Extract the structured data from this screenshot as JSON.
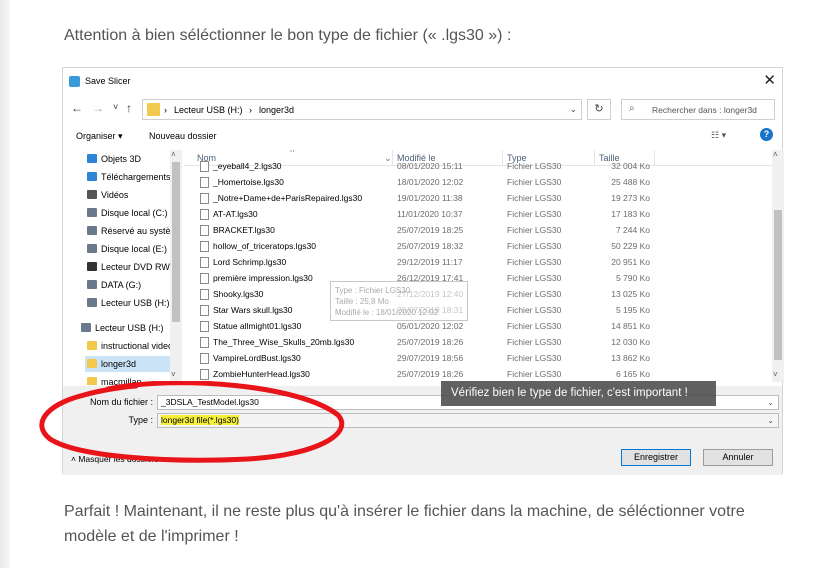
{
  "article": {
    "intro": "Attention à bien séléctionner le bon type de fichier (« .lgs30 ») :",
    "outro": "Parfait ! Maintenant, il ne reste plus qu'à insérer le fichier dans la machine, de séléctionner votre modèle et de l'imprimer !"
  },
  "dialog": {
    "title": "Save Slicer",
    "close": "✕",
    "nav_back": "←",
    "nav_forward": "→",
    "nav_recent": "˅",
    "nav_up": "↑",
    "breadcrumb": [
      "Lecteur USB (H:)",
      "longer3d"
    ],
    "crumb_sep": "›",
    "addr_dropdown": "⌄",
    "refresh": "↻",
    "search_icon": "⌕",
    "search_placeholder": "Rechercher dans : longer3d",
    "toolbar": {
      "organize": "Organiser ▾",
      "new_folder": "Nouveau dossier",
      "view": "☷ ▾",
      "help": "?"
    },
    "nav_pane": [
      "Objets 3D",
      "Téléchargements",
      "Vidéos",
      "Disque local (C:)",
      "Réservé au système",
      "Disque local (E:)",
      "Lecteur DVD RW",
      "DATA (G:)",
      "Lecteur USB (H:)",
      "Lecteur USB (H:)",
      "instructional videos",
      "longer3d",
      "macmillan"
    ],
    "columns": {
      "name": "Nom",
      "modified": "Modifié le",
      "type": "Type",
      "size": "Taille"
    },
    "files": [
      {
        "name": "_eyeball4_2.lgs30",
        "date": "08/01/2020 15:11",
        "type": "Fichier LGS30",
        "size": "32 004 Ko"
      },
      {
        "name": "_Homertoise.lgs30",
        "date": "18/01/2020 12:02",
        "type": "Fichier LGS30",
        "size": "25 488 Ko"
      },
      {
        "name": "_Notre+Dame+de+ParisRepaired.lgs30",
        "date": "19/01/2020 11:38",
        "type": "Fichier LGS30",
        "size": "19 273 Ko"
      },
      {
        "name": "AT-AT.lgs30",
        "date": "11/01/2020 10:37",
        "type": "Fichier LGS30",
        "size": "17 183 Ko"
      },
      {
        "name": "BRACKET.lgs30",
        "date": "25/07/2019 18:25",
        "type": "Fichier LGS30",
        "size": "7 244 Ko"
      },
      {
        "name": "hollow_of_triceratops.lgs30",
        "date": "25/07/2019 18:32",
        "type": "Fichier LGS30",
        "size": "50 229 Ko"
      },
      {
        "name": "Lord Schrimp.lgs30",
        "date": "29/12/2019 11:17",
        "type": "Fichier LGS30",
        "size": "20 951 Ko"
      },
      {
        "name": "première impression.lgs30",
        "date": "26/12/2019 17:41",
        "type": "Fichier LGS30",
        "size": "5 790 Ko"
      },
      {
        "name": "Shooky.lgs30",
        "date": "27/12/2019 12:40",
        "type": "Fichier LGS30",
        "size": "13 025 Ko"
      },
      {
        "name": "Star Wars skull.lgs30",
        "date": "25/07/2019 18:31",
        "type": "Fichier LGS30",
        "size": "5 195 Ko"
      },
      {
        "name": "Statue allmight01.lgs30",
        "date": "05/01/2020 12:02",
        "type": "Fichier LGS30",
        "size": "14 851 Ko"
      },
      {
        "name": "The_Three_Wise_Skulls_20mb.lgs30",
        "date": "25/07/2019 18:26",
        "type": "Fichier LGS30",
        "size": "12 030 Ko"
      },
      {
        "name": "VampireLordBust.lgs30",
        "date": "29/07/2019 18:56",
        "type": "Fichier LGS30",
        "size": "13 862 Ko"
      },
      {
        "name": "ZombieHunterHead.lgs30",
        "date": "25/07/2019 18:26",
        "type": "Fichier LGS30",
        "size": "6 165 Ko"
      }
    ],
    "tooltip": [
      "Type : Fichier LGS30",
      "Taille : 25,8 Mo",
      "Modifié le : 18/01/2020 12:02"
    ],
    "filename_label": "Nom du fichier :",
    "filename_value": "_3DSLA_TestModel.lgs30",
    "type_label": "Type :",
    "type_value": "longer3d file(*.lgs30)",
    "field_dropdown": "⌄",
    "hide_folders": "˄ Masquer les dossiers",
    "save_button": "Enregistrer",
    "cancel_button": "Annuler",
    "scroll_up": "˄",
    "scroll_down": "˅"
  },
  "banner": "Vérifiez bien le type de fichier, c'est important !",
  "colors": {
    "annotation_red": "#e8141a",
    "highlight_yellow": "#f6ef3a",
    "selection_blue": "#cce4f7"
  }
}
